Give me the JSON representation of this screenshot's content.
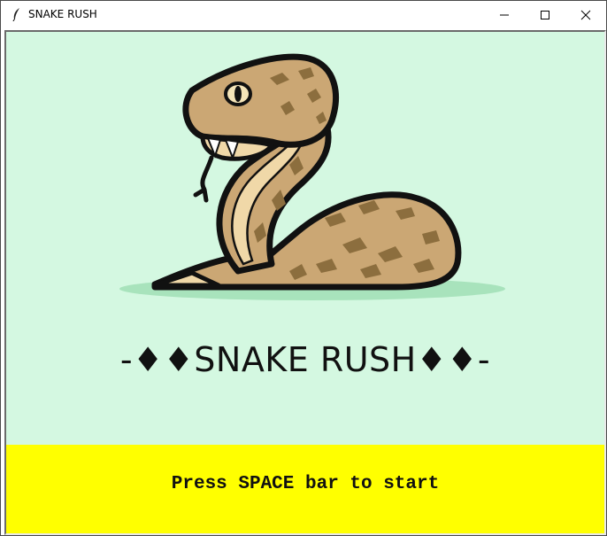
{
  "window": {
    "title": "SNAKE RUSH"
  },
  "titlebar_icons": {
    "app": "feather-icon",
    "minimize": "minimize-icon",
    "maximize": "maximize-icon",
    "close": "close-icon"
  },
  "game": {
    "title": "-♦♦SNAKE RUSH♦♦-",
    "prompt": "Press SPACE bar to start",
    "art": "snake-illustration"
  },
  "colors": {
    "scene_bg": "#d4f8e1",
    "prompt_bg": "#ffff00",
    "snake_body": "#cba774",
    "snake_belly": "#f0d8a8",
    "snake_pattern": "#8c6e3e",
    "shadow": "#a8e3bc"
  }
}
